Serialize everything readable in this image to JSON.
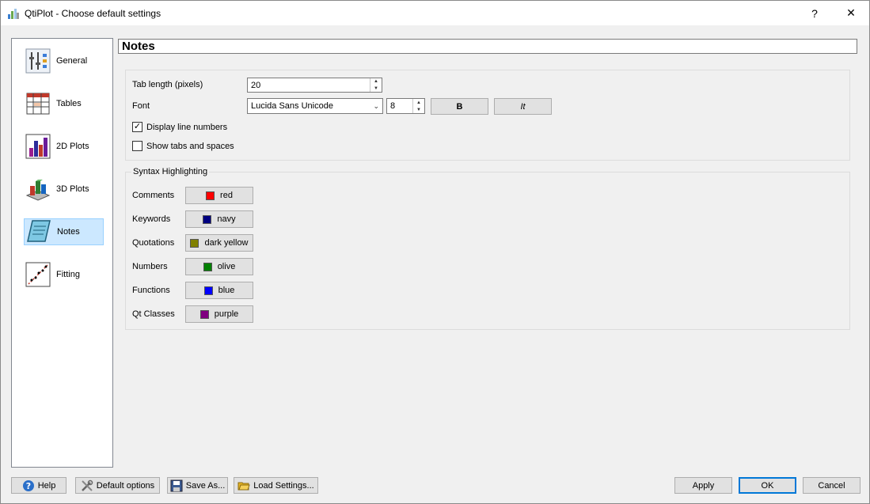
{
  "window": {
    "title": "QtiPlot - Choose default settings",
    "help_glyph": "?",
    "close_glyph": "✕"
  },
  "sidebar": {
    "items": [
      {
        "label": "General",
        "icon": "general-icon"
      },
      {
        "label": "Tables",
        "icon": "tables-icon"
      },
      {
        "label": "2D Plots",
        "icon": "plots-2d-icon"
      },
      {
        "label": "3D Plots",
        "icon": "plots-3d-icon"
      },
      {
        "label": "Notes",
        "icon": "notes-icon",
        "selected": true
      },
      {
        "label": "Fitting",
        "icon": "fitting-icon"
      }
    ]
  },
  "notes": {
    "header": "Notes",
    "tab_length_label": "Tab length (pixels)",
    "tab_length_value": "20",
    "font_label": "Font",
    "font_value": "Lucida Sans Unicode",
    "font_size_value": "8",
    "bold_label": "B",
    "italic_label": "It",
    "display_line_numbers_label": "Display line numbers",
    "display_line_numbers_checked": true,
    "show_tabs_label": "Show tabs and spaces",
    "show_tabs_checked": false,
    "syntax_title": "Syntax Highlighting",
    "syntax_rows": [
      {
        "label": "Comments",
        "color_name": "red",
        "color": "#ff0000"
      },
      {
        "label": "Keywords",
        "color_name": "navy",
        "color": "#000080"
      },
      {
        "label": "Quotations",
        "color_name": "dark yellow",
        "color": "#808000"
      },
      {
        "label": "Numbers",
        "color_name": "olive",
        "color": "#008000"
      },
      {
        "label": "Functions",
        "color_name": "blue",
        "color": "#0000ff"
      },
      {
        "label": "Qt Classes",
        "color_name": "purple",
        "color": "#800080"
      }
    ]
  },
  "buttons": {
    "help": "Help",
    "default_options": "Default options",
    "save_as": "Save As...",
    "load_settings": "Load Settings...",
    "apply": "Apply",
    "ok": "OK",
    "cancel": "Cancel"
  }
}
